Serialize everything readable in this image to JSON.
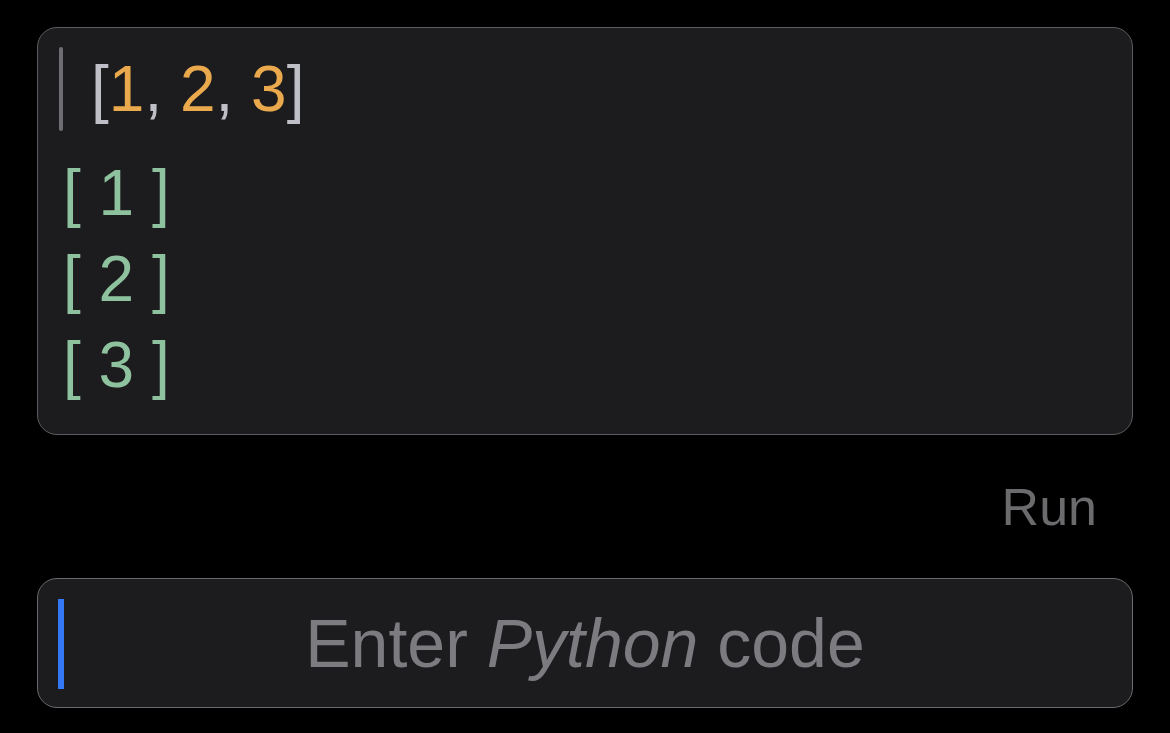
{
  "history": [
    {
      "kind": "input",
      "tokens": [
        {
          "text": "[",
          "kind": "punctuation"
        },
        {
          "text": "1",
          "kind": "number"
        },
        {
          "text": ", ",
          "kind": "punctuation"
        },
        {
          "text": "2",
          "kind": "number"
        },
        {
          "text": ", ",
          "kind": "punctuation"
        },
        {
          "text": "3",
          "kind": "number"
        },
        {
          "text": "]",
          "kind": "punctuation"
        }
      ]
    },
    {
      "kind": "output",
      "text": "[ 1 ]"
    },
    {
      "kind": "output",
      "text": "[ 2 ]"
    },
    {
      "kind": "output",
      "text": "[ 3 ]"
    }
  ],
  "run_button": {
    "label": "Run",
    "disabled": true
  },
  "code_input": {
    "placeholder": "Enter *Python* code",
    "focused": true
  }
}
